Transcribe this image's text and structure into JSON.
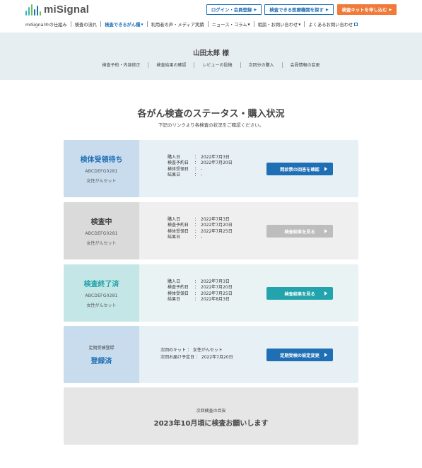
{
  "brand": {
    "name": "miSignal",
    "bar_colors": [
      "#3bb4b9",
      "#3bb4b9",
      "#6cc04a",
      "#1f6fb5",
      "#1f6fb5",
      "#6cc04a"
    ]
  },
  "header": {
    "login_label": "ログイン・会員登録",
    "search_label": "検査できる医療機関を探す",
    "kit_label": "検査キットを申し込む"
  },
  "gnav": [
    {
      "label": "miSignal®の仕組み"
    },
    {
      "label": "検査の流れ"
    },
    {
      "label": "検査できるがん種"
    },
    {
      "label": "利用者の声・メディア実績"
    },
    {
      "label": "ニュース・コラム"
    },
    {
      "label": "相談・お問い合わせ"
    },
    {
      "label": "よくあるお問い合わせ"
    }
  ],
  "user": {
    "name": "山田太郎 様"
  },
  "subnav": [
    "検査予約・内容修正",
    "検査結果の確認",
    "レビューの投稿",
    "次回分の購入",
    "会員情報の変更"
  ],
  "page": {
    "title": "各がん検査のステータス・購入状況",
    "subtitle": "下記のリンクより各検査の状況をご確認ください。"
  },
  "cards": [
    {
      "status": "検体受領待ち",
      "code": "ABCDEFG0281",
      "kit": "女性がんセット",
      "rows": [
        {
          "k": "購入日",
          "v": "2022年7月3日"
        },
        {
          "k": "検査予約日",
          "v": "2022年7月20日"
        },
        {
          "k": "検体受領日",
          "v": "-"
        },
        {
          "k": "結果日",
          "v": "-"
        }
      ],
      "button": "問診票の回答を確認"
    },
    {
      "status": "検査中",
      "code": "ABCDEFG0281",
      "kit": "女性がんセット",
      "rows": [
        {
          "k": "購入日",
          "v": "2022年7月3日"
        },
        {
          "k": "検査予約日",
          "v": "2022年7月20日"
        },
        {
          "k": "検体受領日",
          "v": "2022年7月25日"
        },
        {
          "k": "結果日",
          "v": "-"
        }
      ],
      "button": "検査結果を見る"
    },
    {
      "status": "検査終了済",
      "code": "ABCDEFG0281",
      "kit": "女性がんセット",
      "rows": [
        {
          "k": "購入日",
          "v": "2022年7月3日"
        },
        {
          "k": "検査予約日",
          "v": "2022年7月20日"
        },
        {
          "k": "検体受領日",
          "v": "2022年7月25日"
        },
        {
          "k": "結果日",
          "v": "2022年8月3日"
        }
      ],
      "button": "検査結果を見る"
    },
    {
      "pre": "定期受検登録",
      "status": "登録済",
      "rows": [
        {
          "k": "次回のキット",
          "v": "女性がんセット"
        },
        {
          "k": "次回お届け予定日",
          "v": "2022年7月20日"
        }
      ],
      "button": "定期受検の設定変更"
    }
  ],
  "colon": "：",
  "next": {
    "label": "次回検査の目安",
    "value": "2023年10月頃に検査お願いします"
  }
}
